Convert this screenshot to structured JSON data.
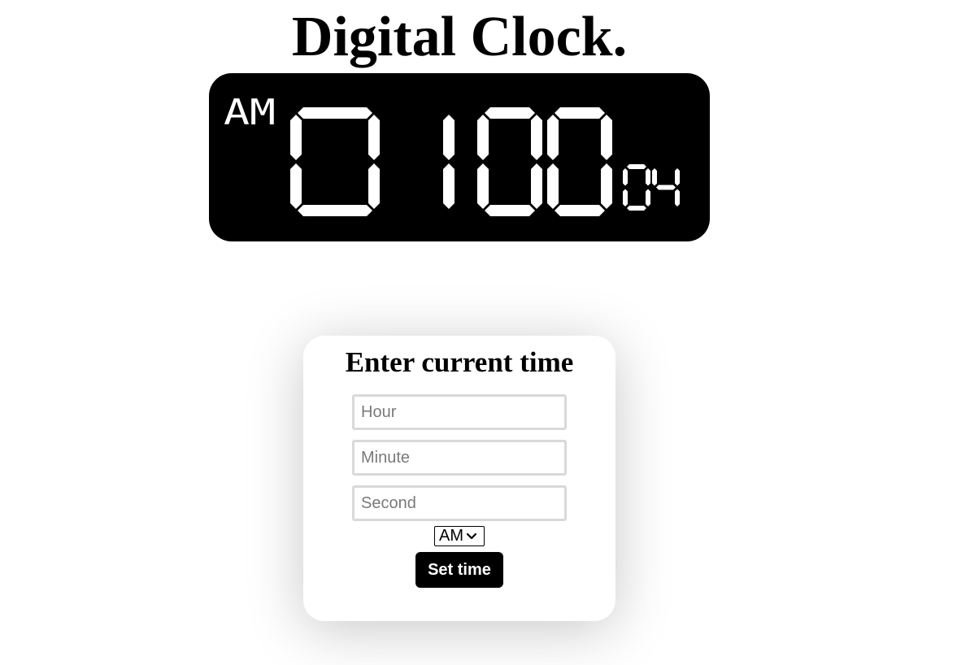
{
  "page": {
    "title": "Digital Clock."
  },
  "clock": {
    "meridiem": "AM",
    "hours": "01",
    "minutes": "00",
    "seconds": "04",
    "colors": {
      "background": "#000000",
      "segment": "#ffffff"
    }
  },
  "form": {
    "heading": "Enter current time",
    "hour_placeholder": "Hour",
    "minute_placeholder": "Minute",
    "second_placeholder": "Second",
    "meridiem_selected": "AM",
    "submit_label": "Set time",
    "icons": {
      "select_arrow": "chevron-down-icon"
    }
  }
}
